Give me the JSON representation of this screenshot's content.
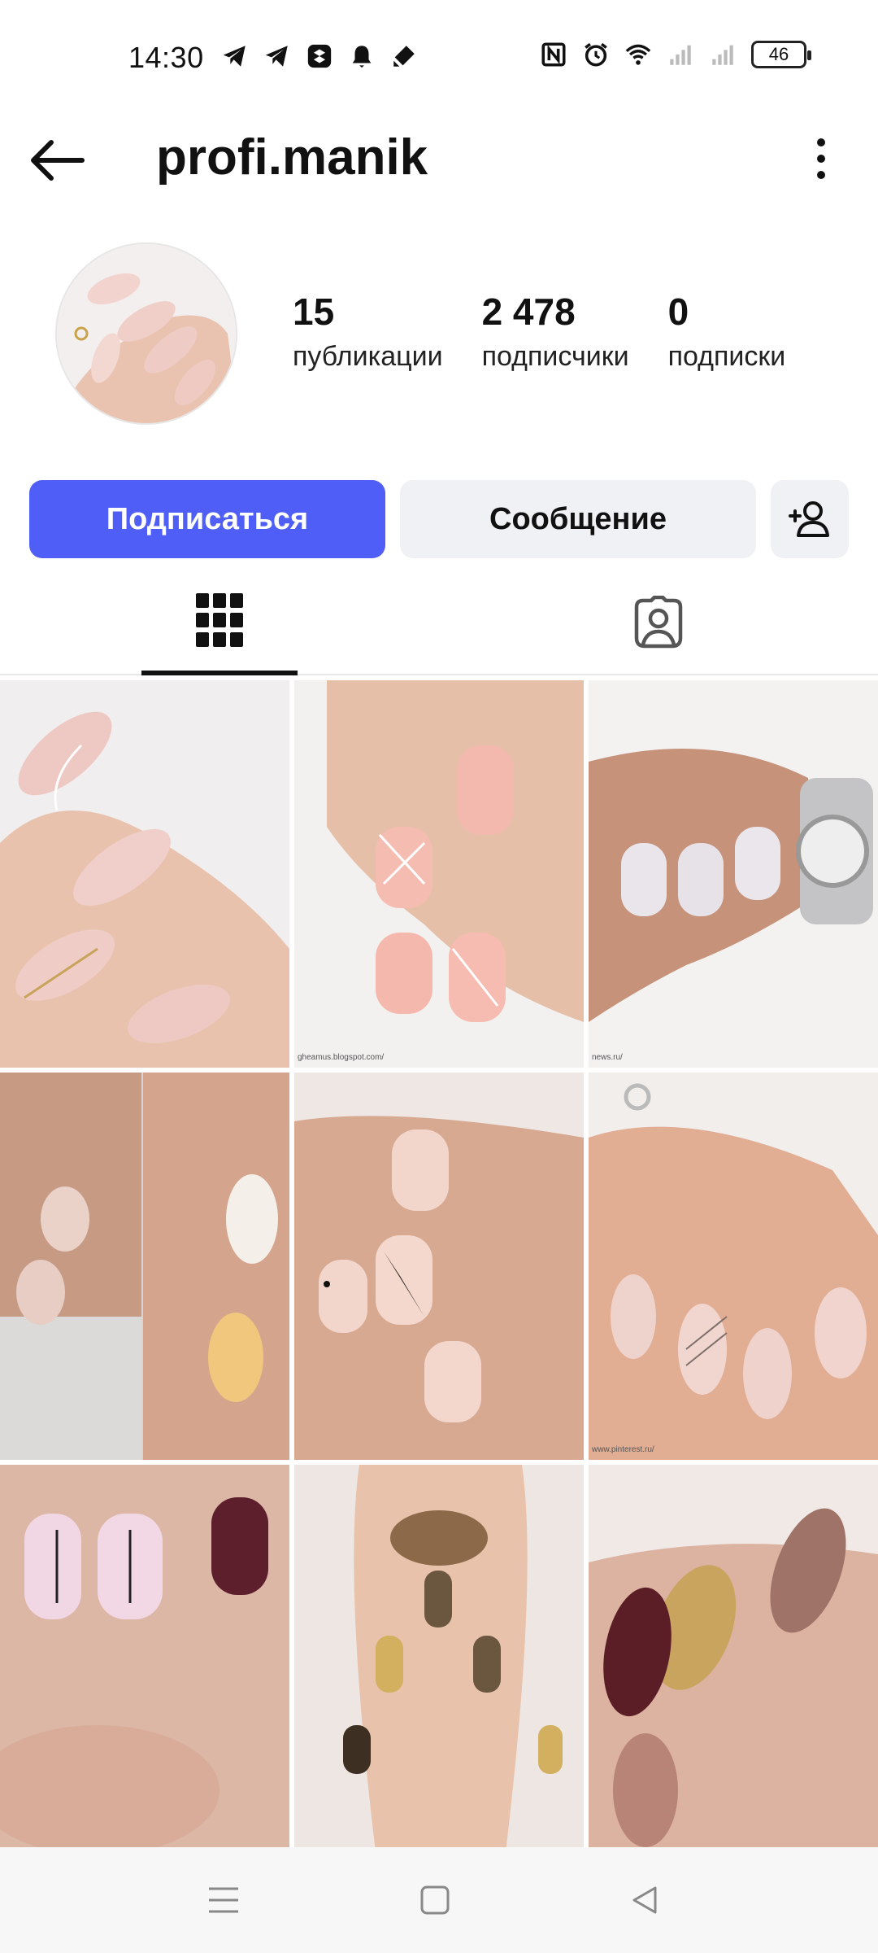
{
  "status_bar": {
    "time": "14:30",
    "battery": "46",
    "icons_left": [
      "telegram-icon",
      "telegram-icon",
      "app-icon",
      "bell-icon",
      "edit-icon"
    ],
    "icons_right": [
      "nfc-icon",
      "alarm-icon",
      "wifi-icon",
      "signal-icon",
      "signal-icon",
      "battery-icon"
    ]
  },
  "header": {
    "username": "profi.manik"
  },
  "profile": {
    "stats": [
      {
        "value": "15",
        "label": "публикации"
      },
      {
        "value": "2 478",
        "label": "подписчики"
      },
      {
        "value": "0",
        "label": "подписки"
      }
    ]
  },
  "actions": {
    "follow": "Подписаться",
    "message": "Сообщение"
  },
  "tabs": [
    "grid-icon",
    "tagged-icon"
  ],
  "posts": [
    {
      "name": "nail-post-1",
      "caption": ""
    },
    {
      "name": "nail-post-2",
      "caption": "gheamus.blogspot.com/"
    },
    {
      "name": "nail-post-3",
      "caption": "news.ru/"
    },
    {
      "name": "nail-post-4",
      "caption": ""
    },
    {
      "name": "nail-post-5",
      "caption": ""
    },
    {
      "name": "nail-post-6",
      "caption": "www.pinterest.ru/"
    },
    {
      "name": "nail-post-7",
      "caption": ""
    },
    {
      "name": "nail-post-8",
      "caption": ""
    },
    {
      "name": "nail-post-9",
      "caption": ""
    }
  ],
  "colors": {
    "accent": "#4f5ef6",
    "button_secondary": "#f0f1f5",
    "text": "#111111"
  }
}
